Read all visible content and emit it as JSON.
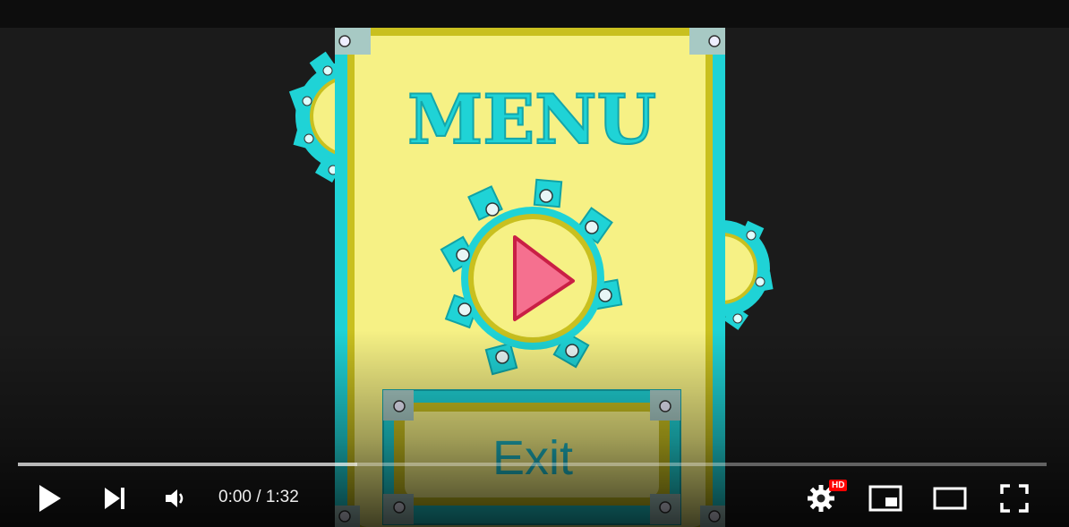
{
  "video": {
    "menu_title": "MENU",
    "exit_label": "Exit",
    "colors": {
      "panel": "#f6f185",
      "panel_border": "#c9c01f",
      "teal": "#1fd3d6",
      "play_triangle": "#f5708f",
      "background": "#1b1b1b"
    }
  },
  "player": {
    "time_text": "0:00 / 1:32",
    "progress_loaded_fraction": 0.33,
    "hd_badge": "HD",
    "controls": [
      "play-icon",
      "next-icon",
      "volume-icon",
      "settings-icon",
      "miniplayer-icon",
      "theater-icon",
      "fullscreen-icon"
    ]
  }
}
